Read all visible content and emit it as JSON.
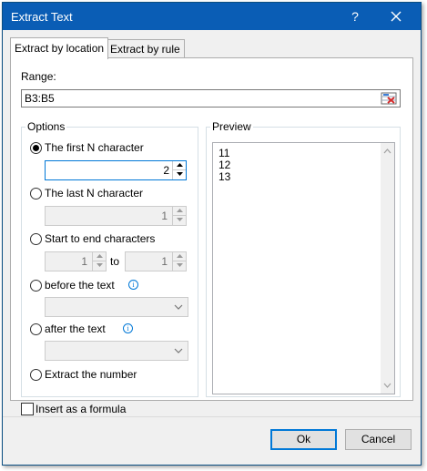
{
  "window": {
    "title": "Extract Text",
    "help_label": "?"
  },
  "tabs": [
    {
      "label": "Extract by location"
    },
    {
      "label": "Extract by rule"
    }
  ],
  "range": {
    "label": "Range:",
    "value": "B3:B5"
  },
  "options": {
    "title": "Options",
    "first_n": {
      "label": "The first N character",
      "value": "2",
      "selected": true
    },
    "last_n": {
      "label": "The last N character",
      "value": "1",
      "selected": false
    },
    "start_end": {
      "label": "Start to end characters",
      "from": "1",
      "to_label": "to",
      "to": "1",
      "selected": false
    },
    "before_text": {
      "label": "before the text",
      "value": "",
      "selected": false
    },
    "after_text": {
      "label": "after the text",
      "value": "",
      "selected": false
    },
    "extract_number": {
      "label": "Extract the number",
      "selected": false
    }
  },
  "preview": {
    "title": "Preview",
    "lines": [
      "11",
      "12",
      "13"
    ]
  },
  "insert_formula": {
    "label": "Insert as a formula",
    "checked": false
  },
  "buttons": {
    "ok": "Ok",
    "cancel": "Cancel"
  },
  "colors": {
    "titlebar": "#0a5db5",
    "accent": "#0078d7",
    "range_icon_red": "#d62b2b"
  },
  "icons": [
    "help-icon",
    "close-icon",
    "range-select-icon",
    "info-icon",
    "spin-up-icon",
    "spin-down-icon",
    "chevron-down-icon"
  ]
}
